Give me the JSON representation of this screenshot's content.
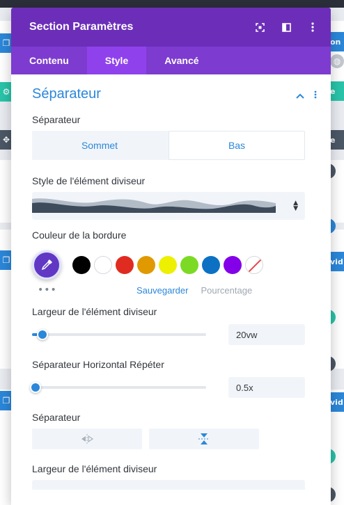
{
  "background": {
    "right_tabs": [
      "on",
      "e",
      "e",
      "vid",
      "vid"
    ]
  },
  "modal": {
    "title": "Section Paramètres",
    "tabs": [
      {
        "label": "Contenu",
        "active": false
      },
      {
        "label": "Style",
        "active": true
      },
      {
        "label": "Avancé",
        "active": false
      }
    ],
    "section_title": "Séparateur",
    "separator_position": {
      "label": "Séparateur",
      "options": [
        "Sommet",
        "Bas"
      ],
      "selected": "Sommet"
    },
    "divider_style": {
      "label": "Style de l'élément diviseur"
    },
    "border_color": {
      "label": "Couleur de la bordure",
      "swatches": [
        "#000000",
        "#ffffff",
        "#e02b20",
        "#e09900",
        "#edf000",
        "#7cda24",
        "#0c71c3",
        "#8300e9",
        "none"
      ],
      "save_label": "Sauvegarder",
      "percent_label": "Pourcentage"
    },
    "divider_width": {
      "label": "Largeur de l'élément diviseur",
      "value": "20vw",
      "fraction": 0.06
    },
    "horizontal_repeat": {
      "label": "Séparateur Horizontal Répéter",
      "value": "0.5x",
      "fraction": 0.02
    },
    "flip": {
      "label": "Séparateur"
    },
    "divider_width_2": {
      "label": "Largeur de l'élément diviseur"
    }
  },
  "colors": {
    "header": "#6c2eb9",
    "tabs": "#7d3bcf",
    "active_tab": "#8f42ec",
    "accent": "#2b87da"
  }
}
